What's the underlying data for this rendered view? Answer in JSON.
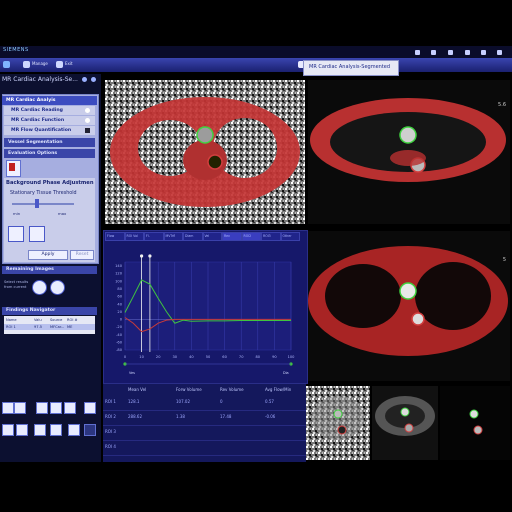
{
  "brand": "SIEMENS",
  "toolbar": {
    "item1": "Manage",
    "item2": "Exit"
  },
  "active_tab": "MR Cardiac Analysis-Segmented",
  "left_panel": {
    "title": "MR Cardiac Analysis-Se...",
    "accordion_header": "MR Cardiac Analyis",
    "items": [
      "MR Cardiac Reading",
      "MR Cardiac Function",
      "MR Flow Quantification"
    ],
    "vessel_seg": "Vessel Segmentation",
    "eval_options": "Evaluation Options",
    "bpa_title": "Background Phase Adjustmen",
    "threshold_label": "Stationary Tissue Threshold",
    "min_label": "min",
    "max_label": "max",
    "apply_label": "Apply",
    "reset_label": "Reset",
    "remaining": "Remaining Images",
    "remaining_hint": "Select results from current",
    "findings": "Findings Navigator",
    "findings_cols": [
      "Name",
      "Valu",
      "Source",
      "ROI #"
    ],
    "findings_row": [
      "ROI 1",
      "97.5",
      "MFCar...",
      "ME"
    ]
  },
  "graph": {
    "tabs": [
      "Flow",
      "ROI Vol",
      "Fl.",
      "MVTrfl",
      "Diam",
      "Vel",
      "Rev",
      "ROI2",
      "ROI3",
      "Other"
    ],
    "y_ticks": [
      "140",
      "120",
      "100",
      "80",
      "60",
      "40",
      "20",
      "0",
      "-20",
      "-40",
      "-60",
      "-80"
    ],
    "x_ticks": [
      "0",
      "10",
      "20",
      "30",
      "40",
      "50",
      "60",
      "70",
      "80",
      "90",
      "100"
    ],
    "x_label_left": "Ves",
    "x_label_right": "Dia"
  },
  "chart_data": {
    "type": "line",
    "title": "",
    "xlabel": "",
    "ylabel": "",
    "ylim": [
      -80,
      150
    ],
    "x": [
      0,
      5,
      10,
      15,
      20,
      25,
      30,
      35,
      40,
      50,
      60,
      70,
      80,
      90,
      100
    ],
    "series": [
      {
        "color": "#3fc43f",
        "values": [
          18,
          60,
          103,
          92,
          55,
          20,
          -10,
          -2,
          -5,
          -4,
          -4,
          -3,
          -3,
          -3,
          -3
        ]
      },
      {
        "color": "#c63a3a",
        "values": [
          5,
          -10,
          -32,
          -25,
          -10,
          -2,
          0,
          0,
          0,
          0,
          0,
          0,
          0,
          0,
          0
        ]
      }
    ],
    "markers": [
      10,
      15
    ]
  },
  "table": {
    "headers": [
      "Mean Vel",
      "Forw Volume",
      "Rev Volume",
      "Avg Flow/Min"
    ],
    "rows": [
      {
        "name": "ROI 1",
        "values": [
          "128.1",
          "107.02",
          "0",
          "0.57"
        ]
      },
      {
        "name": "ROI 2",
        "values": [
          "288.62",
          "1.38",
          "17.48",
          "-0.06"
        ]
      },
      {
        "name": "ROI 3",
        "values": [
          "",
          "",
          "",
          ""
        ]
      },
      {
        "name": "ROI 4",
        "values": [
          "",
          "",
          "",
          ""
        ]
      }
    ]
  },
  "image_labels": {
    "top_right_number": "5.6",
    "mid_right_number": "5"
  }
}
